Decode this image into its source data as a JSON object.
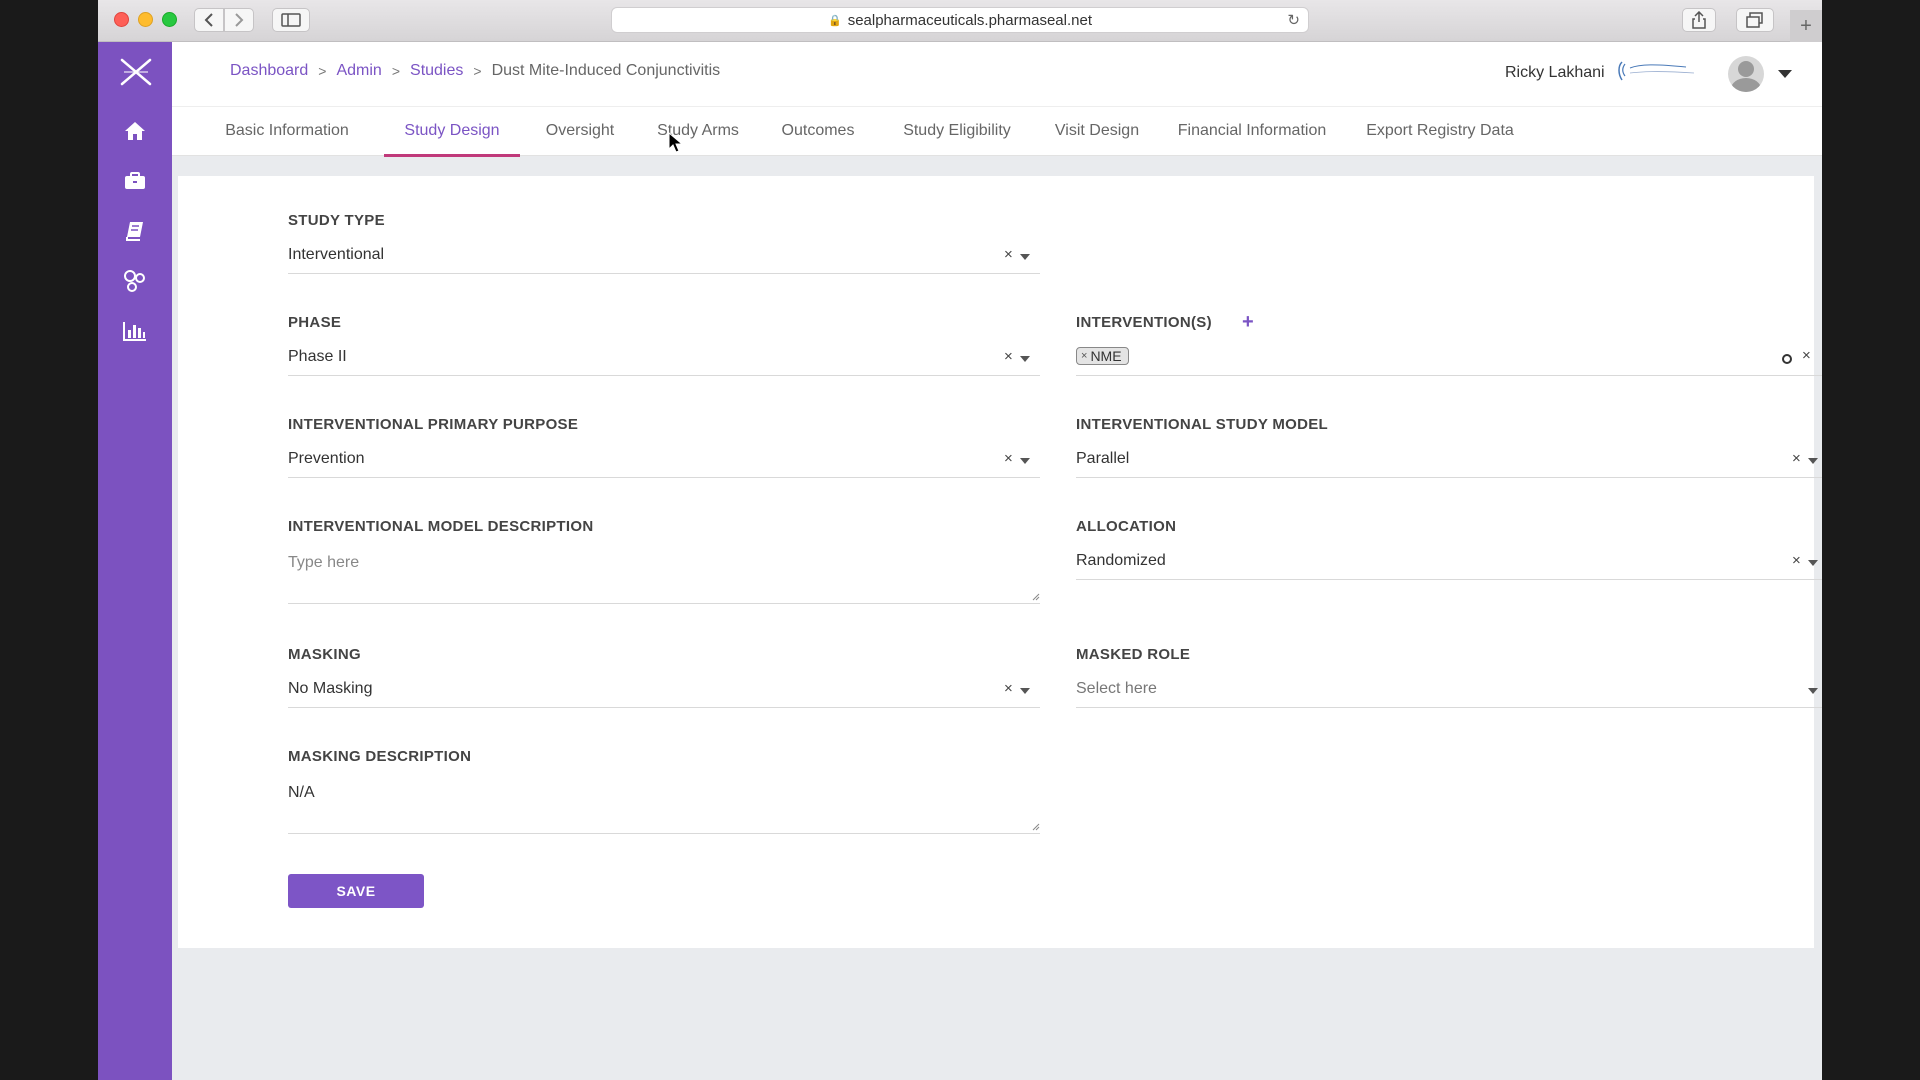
{
  "browser": {
    "url": "sealpharmaceuticals.pharmaseal.net"
  },
  "breadcrumb": {
    "items": [
      "Dashboard",
      "Admin",
      "Studies"
    ],
    "current": "Dust Mite-Induced Conjunctivitis",
    "separator": ">"
  },
  "user": {
    "name": "Ricky Lakhani"
  },
  "tabs": [
    {
      "label": "Basic Information"
    },
    {
      "label": "Study Design"
    },
    {
      "label": "Oversight"
    },
    {
      "label": "Study Arms"
    },
    {
      "label": "Outcomes"
    },
    {
      "label": "Study Eligibility"
    },
    {
      "label": "Visit Design"
    },
    {
      "label": "Financial Information"
    },
    {
      "label": "Export Registry Data"
    }
  ],
  "active_tab": "Study Design",
  "form": {
    "study_type": {
      "label": "STUDY TYPE",
      "value": "Interventional"
    },
    "phase": {
      "label": "PHASE",
      "value": "Phase II"
    },
    "interventions": {
      "label": "INTERVENTION(S)",
      "tags": [
        "NME"
      ]
    },
    "primary_purpose": {
      "label": "INTERVENTIONAL PRIMARY PURPOSE",
      "value": "Prevention"
    },
    "study_model": {
      "label": "INTERVENTIONAL STUDY MODEL",
      "value": "Parallel"
    },
    "model_description": {
      "label": "INTERVENTIONAL MODEL DESCRIPTION",
      "placeholder": "Type here"
    },
    "allocation": {
      "label": "ALLOCATION",
      "value": "Randomized"
    },
    "masking": {
      "label": "MASKING",
      "value": "No Masking"
    },
    "masked_role": {
      "label": "MASKED ROLE",
      "placeholder": "Select here"
    },
    "masking_description": {
      "label": "MASKING DESCRIPTION",
      "value": "N/A"
    },
    "save_label": "SAVE",
    "clear_glyph": "×"
  },
  "colors": {
    "sidebar": "#7c52c0",
    "accent": "#7b54c4",
    "active_tab_underline": "#c0397a",
    "save_button": "#7d55c6"
  },
  "icons": {
    "sidebar": [
      "app-logo-icon",
      "home-icon",
      "briefcase-icon",
      "book-icon",
      "molecule-icon",
      "bar-chart-icon"
    ]
  }
}
